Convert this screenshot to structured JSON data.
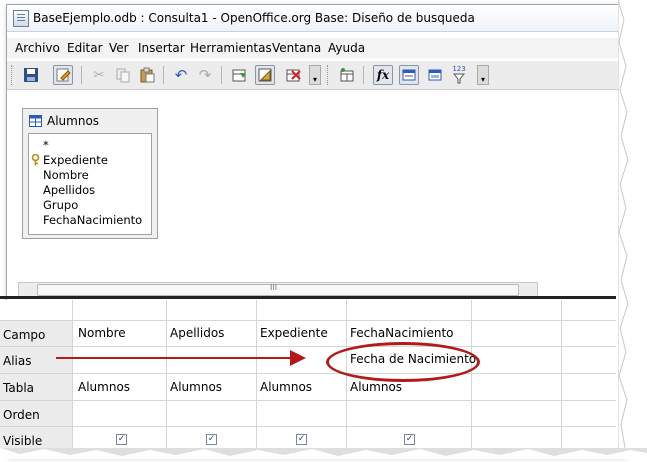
{
  "window": {
    "title": "BaseEjemplo.odb : Consulta1 - OpenOffice.org Base: Diseño de busqueda"
  },
  "menubar": {
    "items": [
      "Archivo",
      "Editar",
      "Ver",
      "Insertar",
      "Herramientas",
      "Ventana",
      "Ayuda"
    ]
  },
  "toolbar": {
    "icons": [
      "save-icon",
      "edit-mode-icon",
      "cut-icon",
      "copy-icon",
      "paste-icon",
      "undo-icon",
      "redo-icon",
      "add-table-icon",
      "design-view-icon",
      "delete-table-icon",
      "more-icon",
      "add-tables-icon",
      "functions-icon",
      "table-name-icon",
      "alias-icon",
      "distinct-values-icon",
      "more-icon"
    ],
    "functions_glyph": "fx",
    "distinct_glyph": "123"
  },
  "table_window": {
    "title": "Alumnos",
    "fields": [
      "*",
      "Expediente",
      "Nombre",
      "Apellidos",
      "Grupo",
      "FechaNacimiento"
    ],
    "key_field_index": 1
  },
  "scrollbar": {
    "grip": "III"
  },
  "grid": {
    "row_headers": [
      "Campo",
      "Alias",
      "Tabla",
      "Orden",
      "Visible"
    ],
    "campo": [
      "Nombre",
      "Apellidos",
      "Expediente",
      "FechaNacimiento",
      "",
      ""
    ],
    "alias": [
      "",
      "",
      "",
      "Fecha de Nacimiento",
      "",
      ""
    ],
    "tabla": [
      "Alumnos",
      "Alumnos",
      "Alumnos",
      "Alumnos",
      "",
      ""
    ],
    "orden": [
      "",
      "",
      "",
      "",
      "",
      ""
    ],
    "visible": [
      true,
      true,
      true,
      true,
      false,
      false
    ]
  },
  "annotation": {
    "color": "#b31b1b"
  }
}
